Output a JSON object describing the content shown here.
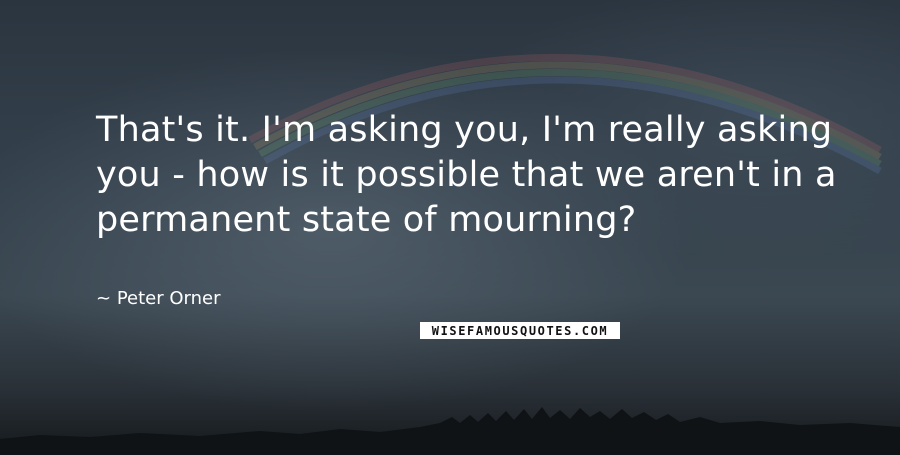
{
  "quote": {
    "text": "That's it. I'm asking you, I'm really asking you - how is it possible that we aren't in a permanent state of mourning?"
  },
  "author": {
    "prefix": "~",
    "name": "Peter Orner"
  },
  "watermark": {
    "text": "WISEFAMOUSQUOTES.COM"
  },
  "colors": {
    "text": "#ffffff",
    "sky_top": "#2b3540",
    "sky_mid": "#3b4852",
    "ground": "#15191c"
  }
}
